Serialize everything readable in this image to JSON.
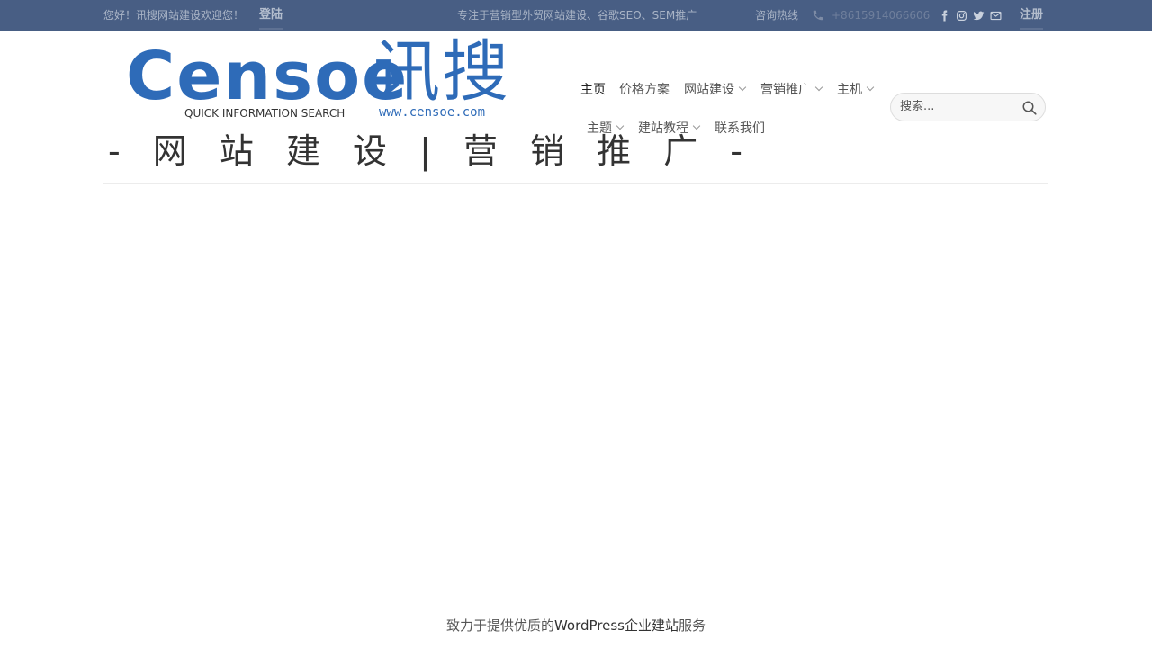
{
  "topbar": {
    "greeting": "您好！讯搜网站建设欢迎您！",
    "login": "登陆",
    "slogan": "专注于营销型外贸网站建设、谷歌SEO、SEM推广",
    "hotline_label": "咨询热线",
    "phone": "+8615914066606",
    "register": "注册",
    "bg_color": "#485e84"
  },
  "logo": {
    "brand": "Censoe",
    "brand_cn": "讯搜",
    "subtitle": "QUICK INFORMATION SEARCH",
    "url": "www.censoe.com",
    "tagline": "- 网 站 建 设 | 营 销 推 广 -",
    "brand_color": "#2e6bb8"
  },
  "nav": {
    "row1": [
      {
        "label": "主页",
        "dropdown": false,
        "active": true
      },
      {
        "label": "价格方案",
        "dropdown": false
      },
      {
        "label": "网站建设",
        "dropdown": true
      },
      {
        "label": "营销推广",
        "dropdown": true
      },
      {
        "label": "主机",
        "dropdown": true
      }
    ],
    "row2": [
      {
        "label": "主题",
        "dropdown": true
      },
      {
        "label": "建站教程",
        "dropdown": true
      },
      {
        "label": "联系我们",
        "dropdown": false
      }
    ]
  },
  "search": {
    "placeholder": "搜索..."
  },
  "footer": {
    "text_pre": "致力于提供优质的",
    "text_link": "WordPress企业建站",
    "text_post": "服务"
  }
}
